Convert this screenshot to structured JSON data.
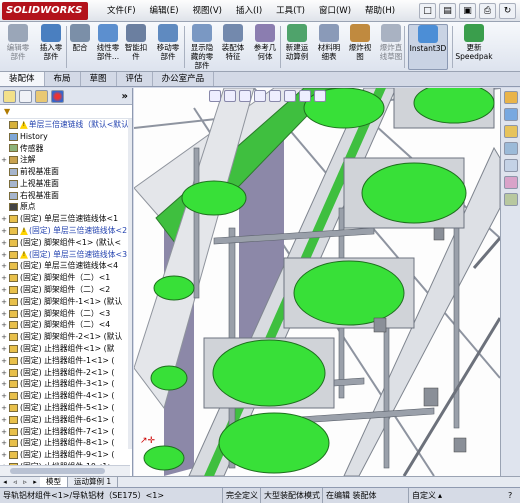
{
  "app": {
    "logo_text": "SOLIDWORKS"
  },
  "menu": [
    "文件(F)",
    "编辑(E)",
    "视图(V)",
    "插入(I)",
    "工具(T)",
    "窗口(W)",
    "帮助(H)"
  ],
  "quick_access": [
    "new-icon",
    "open-icon",
    "save-icon",
    "print-icon",
    "rebuild-icon"
  ],
  "commands": [
    {
      "label1": "编辑零",
      "label2": "部件",
      "dim": true,
      "color": "#9aa6b8"
    },
    {
      "label1": "插入零",
      "label2": "部件",
      "dim": false,
      "color": "#4a7fc0"
    },
    {
      "label1": "配合",
      "label2": "",
      "dim": false,
      "color": "#7b8fa8"
    },
    {
      "label1": "线性零",
      "label2": "部件...",
      "dim": false,
      "color": "#5c8fcf"
    },
    {
      "label1": "智能扣",
      "label2": "件",
      "dim": false,
      "color": "#6b7fa0"
    },
    {
      "label1": "移动零",
      "label2": "部件",
      "dim": false,
      "color": "#5f8ac0"
    },
    {
      "label1": "显示隐",
      "label2": "藏的零",
      "label3": "部件",
      "dim": false,
      "color": "#7a98c3"
    },
    {
      "label1": "装配体",
      "label2": "特征",
      "dim": false,
      "color": "#7389ad"
    },
    {
      "label1": "参考几",
      "label2": "何体",
      "dim": false,
      "color": "#8b7db0"
    },
    {
      "label1": "新建运",
      "label2": "动算例",
      "dim": false,
      "color": "#4fa36b"
    },
    {
      "label1": "材料明",
      "label2": "细表",
      "dim": false,
      "color": "#8a9ab8"
    },
    {
      "label1": "爆炸视",
      "label2": "图",
      "dim": false,
      "color": "#c08a3f"
    },
    {
      "label1": "爆炸直",
      "label2": "线草图",
      "dim": true,
      "color": "#a9b2c2"
    },
    {
      "label1": "Instant3D",
      "label2": "",
      "dim": false,
      "active": true,
      "color": "#4c8ed6"
    },
    {
      "label1": "更新",
      "label2": "Speedpak",
      "dim": false,
      "color": "#3a9e4c"
    }
  ],
  "tabs": [
    "装配体",
    "布局",
    "草图",
    "评估",
    "办公室产品"
  ],
  "tree": [
    {
      "label": "单层三倍速链线（默认<默认_",
      "type": "top",
      "blue": true,
      "warn": true
    },
    {
      "label": "History",
      "type": "history"
    },
    {
      "label": "传感器",
      "type": "sensor"
    },
    {
      "label": "注解",
      "type": "annotation",
      "expand": "+"
    },
    {
      "label": "前视基准面",
      "type": "plane"
    },
    {
      "label": "上视基准面",
      "type": "plane"
    },
    {
      "label": "右视基准面",
      "type": "plane"
    },
    {
      "label": "原点",
      "type": "origin"
    },
    {
      "label": "(固定) 单层三倍速链线体<1",
      "type": "part",
      "expand": "+"
    },
    {
      "label": "(固定) 单层三倍速链线体<2",
      "type": "part",
      "expand": "+",
      "blue": true,
      "warn": true
    },
    {
      "label": "(固定) 脚架组件<1> (默认<",
      "type": "part",
      "expand": "+"
    },
    {
      "label": "(固定) 单层三倍速链线体<3",
      "type": "part",
      "expand": "+",
      "blue": true,
      "warn": true
    },
    {
      "label": "(固定) 单层三倍速链线体<4",
      "type": "part",
      "expand": "+"
    },
    {
      "label": "(固定) 脚架组件（二）<1",
      "type": "part",
      "expand": "+"
    },
    {
      "label": "(固定) 脚架组件（二）<2",
      "type": "part",
      "expand": "+"
    },
    {
      "label": "(固定) 脚架组件-1<1> (默认",
      "type": "part",
      "expand": "+"
    },
    {
      "label": "(固定) 脚架组件（二）<3",
      "type": "part",
      "expand": "+"
    },
    {
      "label": "(固定) 脚架组件（二）<4",
      "type": "part",
      "expand": "+"
    },
    {
      "label": "(固定) 脚架组件-2<1> (默认",
      "type": "part",
      "expand": "+"
    },
    {
      "label": "(固定) 止挡器组件<1> (默",
      "type": "part",
      "expand": "+"
    },
    {
      "label": "(固定) 止挡器组件-1<1> (",
      "type": "part",
      "expand": "+"
    },
    {
      "label": "(固定) 止挡器组件-2<1> (",
      "type": "part",
      "expand": "+"
    },
    {
      "label": "(固定) 止挡器组件-3<1> (",
      "type": "part",
      "expand": "+"
    },
    {
      "label": "(固定) 止挡器组件-4<1> (",
      "type": "part",
      "expand": "+"
    },
    {
      "label": "(固定) 止挡器组件-5<1> (",
      "type": "part",
      "expand": "+"
    },
    {
      "label": "(固定) 止挡器组件-6<1> (",
      "type": "part",
      "expand": "+"
    },
    {
      "label": "(固定) 止挡器组件-7<1> (",
      "type": "part",
      "expand": "+"
    },
    {
      "label": "(固定) 止挡器组件-8<1> (",
      "type": "part",
      "expand": "+"
    },
    {
      "label": "(固定) 止挡器组件-9<1> (",
      "type": "part",
      "expand": "+"
    },
    {
      "label": "(固定) 止挡器组件-10<1>",
      "type": "part",
      "expand": "+"
    }
  ],
  "model_tabs": [
    "模型",
    "运动算例 1"
  ],
  "status": {
    "selection": "导轨铝材组件<1>/导轨铝材（SE175）<1>",
    "definition": "完全定义",
    "mode": "大型装配体模式",
    "editing": "在编辑 装配体",
    "units": "自定义"
  },
  "colors": {
    "tray_green": "#38e038",
    "frame_gray": "#9aa0aa",
    "belt_green": "#3fbf3f",
    "rail_purple": "#8c88a8"
  }
}
